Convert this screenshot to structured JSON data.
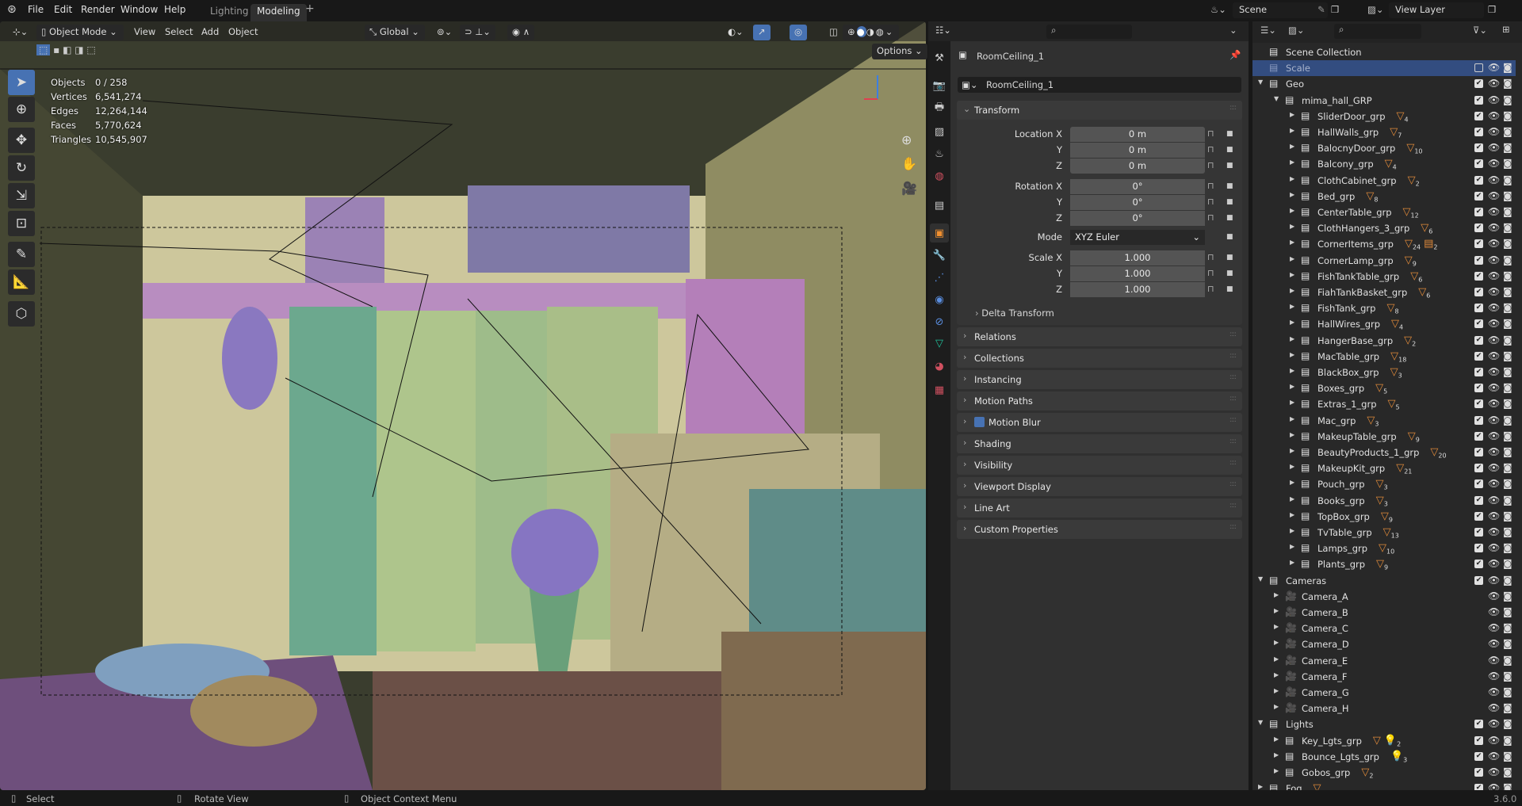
{
  "topbar": {
    "menus": [
      "File",
      "Edit",
      "Render",
      "Window",
      "Help"
    ],
    "workspaces": [
      {
        "label": "Lighting",
        "active": false
      },
      {
        "label": "Modeling",
        "active": true
      }
    ],
    "add_workspace": "+",
    "scene": "Scene",
    "view_layer": "View Layer"
  },
  "viewport": {
    "mode": "Object Mode",
    "menus": [
      "View",
      "Select",
      "Add",
      "Object"
    ],
    "orientation": "Global",
    "options_label": "Options",
    "stats": [
      {
        "label": "Objects",
        "value": "0 / 258"
      },
      {
        "label": "Vertices",
        "value": "6,541,274"
      },
      {
        "label": "Edges",
        "value": "12,264,144"
      },
      {
        "label": "Faces",
        "value": "5,770,624"
      },
      {
        "label": "Triangles",
        "value": "10,545,907"
      }
    ],
    "tools": [
      "select-box",
      "cursor",
      "move",
      "rotate",
      "scale",
      "transform",
      "annotate",
      "measure",
      "add-cube"
    ],
    "active_tool": "select-box",
    "shading_active": "solid",
    "accent": "#4772b3"
  },
  "properties": {
    "object_name": "RoomCeiling_1",
    "data_name": "RoomCeiling_1",
    "transform_title": "Transform",
    "location": {
      "label": "Location X",
      "x": "0 m",
      "y": "0 m",
      "z": "0 m"
    },
    "rotation": {
      "label": "Rotation X",
      "x": "0°",
      "y": "0°",
      "z": "0°"
    },
    "mode_label": "Mode",
    "mode_value": "XYZ Euler",
    "scale": {
      "label": "Scale X",
      "x": "1.000",
      "y": "1.000",
      "z": "1.000"
    },
    "axis_y": "Y",
    "axis_z": "Z",
    "delta": "Delta Transform",
    "panels": [
      "Relations",
      "Collections",
      "Instancing",
      "Motion Paths",
      "Motion Blur",
      "Shading",
      "Visibility",
      "Viewport Display",
      "Line Art",
      "Custom Properties"
    ],
    "motion_blur_checked": true,
    "active_tab": "object"
  },
  "outliner": {
    "items": [
      {
        "name": "Scene Collection",
        "level": 0,
        "type": "scene",
        "badges": [],
        "check": null
      },
      {
        "name": "Scale",
        "level": 1,
        "type": "collection",
        "selected": true,
        "badges": [],
        "check": false
      },
      {
        "name": "Geo",
        "level": 1,
        "type": "collection",
        "expanded": true,
        "badges": [],
        "check": true
      },
      {
        "name": "mima_hall_GRP",
        "level": 2,
        "type": "collection",
        "expanded": true,
        "badges": [],
        "check": true
      },
      {
        "name": "SliderDoor_grp",
        "level": 3,
        "type": "collection",
        "badges": [
          {
            "icon": "mesh",
            "count": "4"
          }
        ],
        "check": true
      },
      {
        "name": "HallWalls_grp",
        "level": 3,
        "type": "collection",
        "badges": [
          {
            "icon": "mesh",
            "count": "7"
          }
        ],
        "check": true
      },
      {
        "name": "BalocnyDoor_grp",
        "level": 3,
        "type": "collection",
        "badges": [
          {
            "icon": "mesh",
            "count": "10"
          }
        ],
        "check": true
      },
      {
        "name": "Balcony_grp",
        "level": 3,
        "type": "collection",
        "badges": [
          {
            "icon": "mesh",
            "count": "4"
          }
        ],
        "check": true
      },
      {
        "name": "ClothCabinet_grp",
        "level": 3,
        "type": "collection",
        "badges": [
          {
            "icon": "mesh",
            "count": "2"
          }
        ],
        "check": true
      },
      {
        "name": "Bed_grp",
        "level": 3,
        "type": "collection",
        "badges": [
          {
            "icon": "mesh",
            "count": "8"
          }
        ],
        "check": true
      },
      {
        "name": "CenterTable_grp",
        "level": 3,
        "type": "collection",
        "badges": [
          {
            "icon": "mesh",
            "count": "12"
          }
        ],
        "check": true
      },
      {
        "name": "ClothHangers_3_grp",
        "level": 3,
        "type": "collection",
        "badges": [
          {
            "icon": "mesh",
            "count": "6"
          }
        ],
        "check": true
      },
      {
        "name": "CornerItems_grp",
        "level": 3,
        "type": "collection",
        "badges": [
          {
            "icon": "mesh",
            "count": "24"
          },
          {
            "icon": "collection",
            "count": "2"
          }
        ],
        "check": true
      },
      {
        "name": "CornerLamp_grp",
        "level": 3,
        "type": "collection",
        "badges": [
          {
            "icon": "mesh",
            "count": "9"
          }
        ],
        "check": true
      },
      {
        "name": "FishTankTable_grp",
        "level": 3,
        "type": "collection",
        "badges": [
          {
            "icon": "mesh",
            "count": "6"
          }
        ],
        "check": true
      },
      {
        "name": "FiahTankBasket_grp",
        "level": 3,
        "type": "collection",
        "badges": [
          {
            "icon": "mesh",
            "count": "6"
          }
        ],
        "check": true
      },
      {
        "name": "FishTank_grp",
        "level": 3,
        "type": "collection",
        "badges": [
          {
            "icon": "mesh",
            "count": "8"
          }
        ],
        "check": true
      },
      {
        "name": "HallWires_grp",
        "level": 3,
        "type": "collection",
        "badges": [
          {
            "icon": "mesh",
            "count": "4"
          }
        ],
        "check": true
      },
      {
        "name": "HangerBase_grp",
        "level": 3,
        "type": "collection",
        "badges": [
          {
            "icon": "mesh",
            "count": "2"
          }
        ],
        "check": true
      },
      {
        "name": "MacTable_grp",
        "level": 3,
        "type": "collection",
        "badges": [
          {
            "icon": "mesh",
            "count": "18"
          }
        ],
        "check": true
      },
      {
        "name": "BlackBox_grp",
        "level": 3,
        "type": "collection",
        "badges": [
          {
            "icon": "mesh",
            "count": "3"
          }
        ],
        "check": true
      },
      {
        "name": "Boxes_grp",
        "level": 3,
        "type": "collection",
        "badges": [
          {
            "icon": "mesh",
            "count": "5"
          }
        ],
        "check": true
      },
      {
        "name": "Extras_1_grp",
        "level": 3,
        "type": "collection",
        "badges": [
          {
            "icon": "mesh",
            "count": "5"
          }
        ],
        "check": true
      },
      {
        "name": "Mac_grp",
        "level": 3,
        "type": "collection",
        "badges": [
          {
            "icon": "mesh",
            "count": "3"
          }
        ],
        "check": true
      },
      {
        "name": "MakeupTable_grp",
        "level": 3,
        "type": "collection",
        "badges": [
          {
            "icon": "mesh",
            "count": "9"
          }
        ],
        "check": true
      },
      {
        "name": "BeautyProducts_1_grp",
        "level": 3,
        "type": "collection",
        "badges": [
          {
            "icon": "mesh",
            "count": "20"
          }
        ],
        "check": true
      },
      {
        "name": "MakeupKit_grp",
        "level": 3,
        "type": "collection",
        "badges": [
          {
            "icon": "mesh",
            "count": "21"
          }
        ],
        "check": true
      },
      {
        "name": "Pouch_grp",
        "level": 3,
        "type": "collection",
        "badges": [
          {
            "icon": "mesh",
            "count": "3"
          }
        ],
        "check": true
      },
      {
        "name": "Books_grp",
        "level": 3,
        "type": "collection",
        "badges": [
          {
            "icon": "mesh",
            "count": "3"
          }
        ],
        "check": true
      },
      {
        "name": "TopBox_grp",
        "level": 3,
        "type": "collection",
        "badges": [
          {
            "icon": "mesh",
            "count": "9"
          }
        ],
        "check": true
      },
      {
        "name": "TvTable_grp",
        "level": 3,
        "type": "collection",
        "badges": [
          {
            "icon": "mesh",
            "count": "13"
          }
        ],
        "check": true
      },
      {
        "name": "Lamps_grp",
        "level": 3,
        "type": "collection",
        "badges": [
          {
            "icon": "mesh",
            "count": "10"
          }
        ],
        "check": true
      },
      {
        "name": "Plants_grp",
        "level": 3,
        "type": "collection",
        "badges": [
          {
            "icon": "mesh",
            "count": "9"
          }
        ],
        "check": true
      },
      {
        "name": "Cameras",
        "level": 1,
        "type": "collection",
        "expanded": true,
        "badges": [],
        "check": true
      },
      {
        "name": "Camera_A",
        "level": 2,
        "type": "camera",
        "badges": [
          {
            "icon": "camera-data",
            "count": ""
          }
        ],
        "check": null
      },
      {
        "name": "Camera_B",
        "level": 2,
        "type": "camera",
        "badges": [
          {
            "icon": "camera-data",
            "count": ""
          }
        ],
        "check": null
      },
      {
        "name": "Camera_C",
        "level": 2,
        "type": "camera",
        "badges": [
          {
            "icon": "camera-data",
            "count": ""
          }
        ],
        "check": null
      },
      {
        "name": "Camera_D",
        "level": 2,
        "type": "camera",
        "badges": [
          {
            "icon": "camera-data",
            "count": ""
          }
        ],
        "check": null
      },
      {
        "name": "Camera_E",
        "level": 2,
        "type": "camera",
        "badges": [
          {
            "icon": "camera-data",
            "count": ""
          }
        ],
        "check": null
      },
      {
        "name": "Camera_F",
        "level": 2,
        "type": "camera",
        "badges": [
          {
            "icon": "camera-data",
            "count": ""
          }
        ],
        "check": null
      },
      {
        "name": "Camera_G",
        "level": 2,
        "type": "camera",
        "badges": [
          {
            "icon": "camera-data",
            "count": ""
          }
        ],
        "check": null
      },
      {
        "name": "Camera_H",
        "level": 2,
        "type": "camera",
        "badges": [
          {
            "icon": "camera-data",
            "count": ""
          }
        ],
        "check": null
      },
      {
        "name": "Lights",
        "level": 1,
        "type": "collection",
        "expanded": true,
        "badges": [],
        "check": true
      },
      {
        "name": "Key_Lgts_grp",
        "level": 2,
        "type": "collection",
        "badges": [
          {
            "icon": "mesh",
            "count": ""
          },
          {
            "icon": "light",
            "count": "2"
          }
        ],
        "check": true
      },
      {
        "name": "Bounce_Lgts_grp",
        "level": 2,
        "type": "collection",
        "badges": [
          {
            "icon": "light",
            "count": "3"
          }
        ],
        "check": true
      },
      {
        "name": "Gobos_grp",
        "level": 2,
        "type": "collection",
        "badges": [
          {
            "icon": "mesh",
            "count": "2"
          }
        ],
        "check": true
      },
      {
        "name": "Fog",
        "level": 1,
        "type": "collection",
        "badges": [
          {
            "icon": "mesh",
            "count": ""
          }
        ],
        "check": true
      }
    ]
  },
  "status": {
    "left_click": "Select",
    "middle_click": "Rotate View",
    "right_click": "Object Context Menu",
    "version": "3.6.0"
  }
}
